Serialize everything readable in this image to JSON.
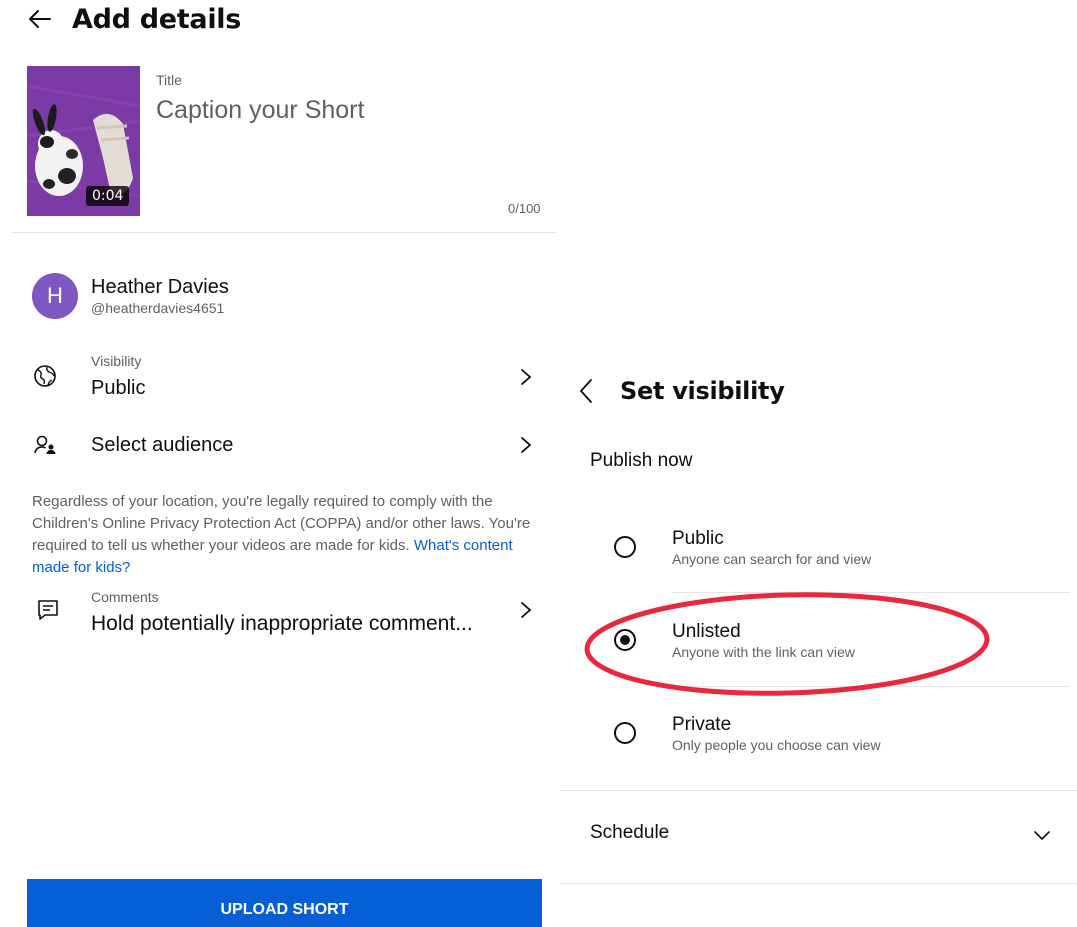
{
  "header": {
    "title": "Add details"
  },
  "video": {
    "duration": "0:04"
  },
  "title_field": {
    "label": "Title",
    "placeholder": "Caption your Short",
    "char_count": "0/100"
  },
  "channel": {
    "avatar_letter": "H",
    "name": "Heather Davies",
    "handle": "@heatherdavies4651"
  },
  "visibility": {
    "label": "Visibility",
    "value": "Public"
  },
  "audience": {
    "label": "Select audience"
  },
  "coppa": {
    "text": "Regardless of your location, you're legally required to comply with the Children's Online Privacy Protection Act (COPPA) and/or other laws. You're required to tell us whether your videos are made for kids.",
    "link": "What's content made for kids?"
  },
  "comments": {
    "label": "Comments",
    "value": "Hold potentially inappropriate comment..."
  },
  "upload_button": "UPLOAD SHORT",
  "set_visibility": {
    "title": "Set visibility",
    "publish_now": "Publish now",
    "options": [
      {
        "title": "Public",
        "subtitle": "Anyone can search for and view",
        "selected": false
      },
      {
        "title": "Unlisted",
        "subtitle": "Anyone with the link can view",
        "selected": true
      },
      {
        "title": "Private",
        "subtitle": "Only people you choose can view",
        "selected": false
      }
    ],
    "schedule": "Schedule"
  },
  "colors": {
    "accent": "#065fd4",
    "avatar": "#7e57c2",
    "highlight": "#e8283c",
    "thumbnail": "#7c3aa6"
  },
  "icons": [
    "back-arrow-icon",
    "globe-icon",
    "audience-icon",
    "comment-icon",
    "chevron-right-icon",
    "chevron-down-icon"
  ]
}
